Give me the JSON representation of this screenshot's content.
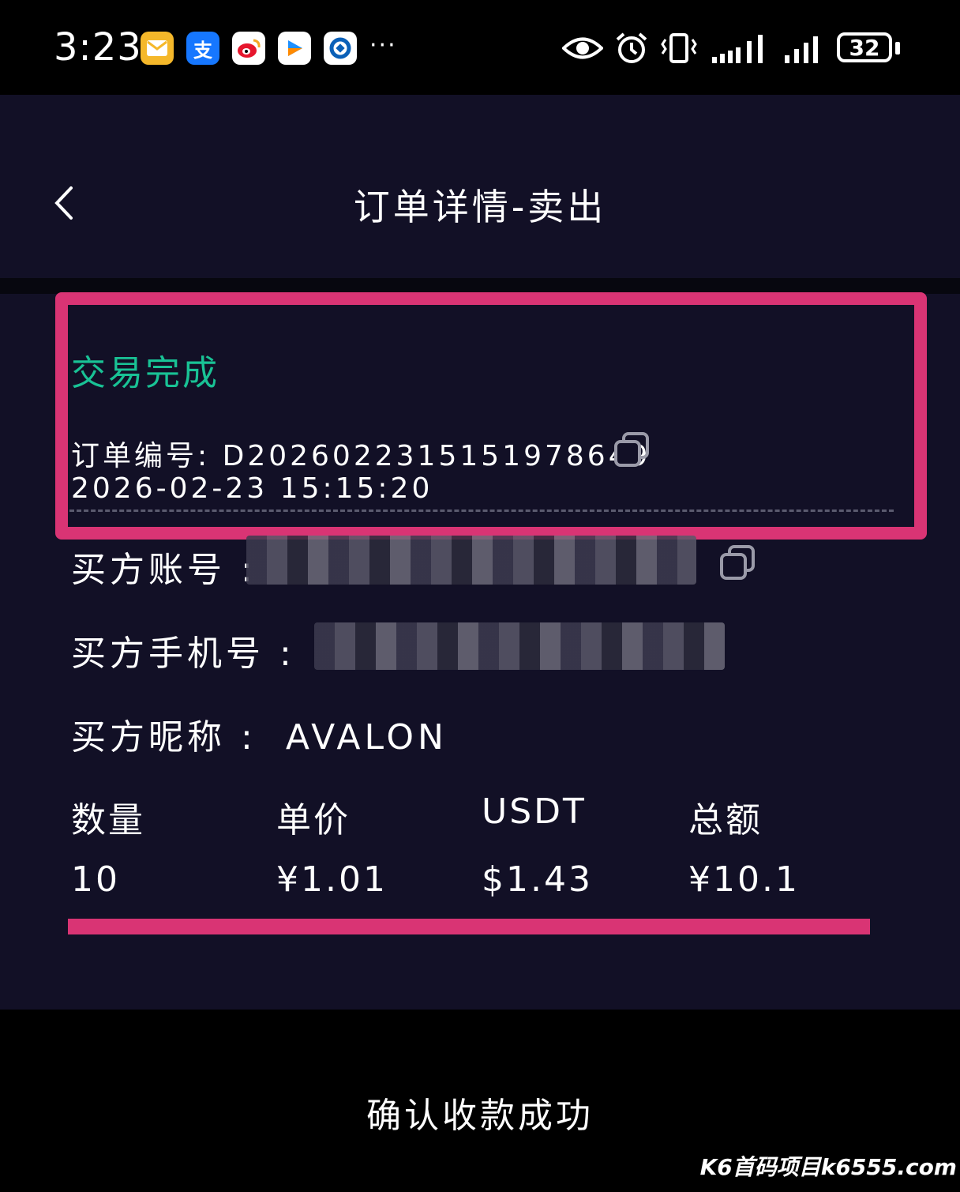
{
  "status_bar": {
    "time": "3:23",
    "apps": [
      "mail-icon",
      "alipay-icon",
      "weibo-icon",
      "video-icon",
      "bank-icon"
    ],
    "alipay_glyph": "支",
    "more": "···",
    "battery": "32"
  },
  "header": {
    "title": "订单详情-卖出",
    "back_icon": "chevron-left-icon"
  },
  "order": {
    "status": "交易完成",
    "status_color": "#19c295",
    "order_no_label": "订单编号:",
    "order_no": "D2026022315151978649",
    "datetime": "2026-02-23 15:15:20"
  },
  "buyer": {
    "account_label": "买方账号 :",
    "phone_label": "买方手机号 :",
    "nickname_label": "买方昵称 :",
    "nickname": "AVALON"
  },
  "table": {
    "headers": [
      "数量",
      "单价",
      "USDT",
      "总额"
    ],
    "values": [
      "10",
      "¥1.01",
      "$1.43",
      "¥10.1"
    ]
  },
  "footer": {
    "confirm_label": "确认收款成功"
  },
  "watermark": "K6首码项目k6555.com",
  "colors": {
    "background": "#121026",
    "highlight": "#d93474"
  }
}
